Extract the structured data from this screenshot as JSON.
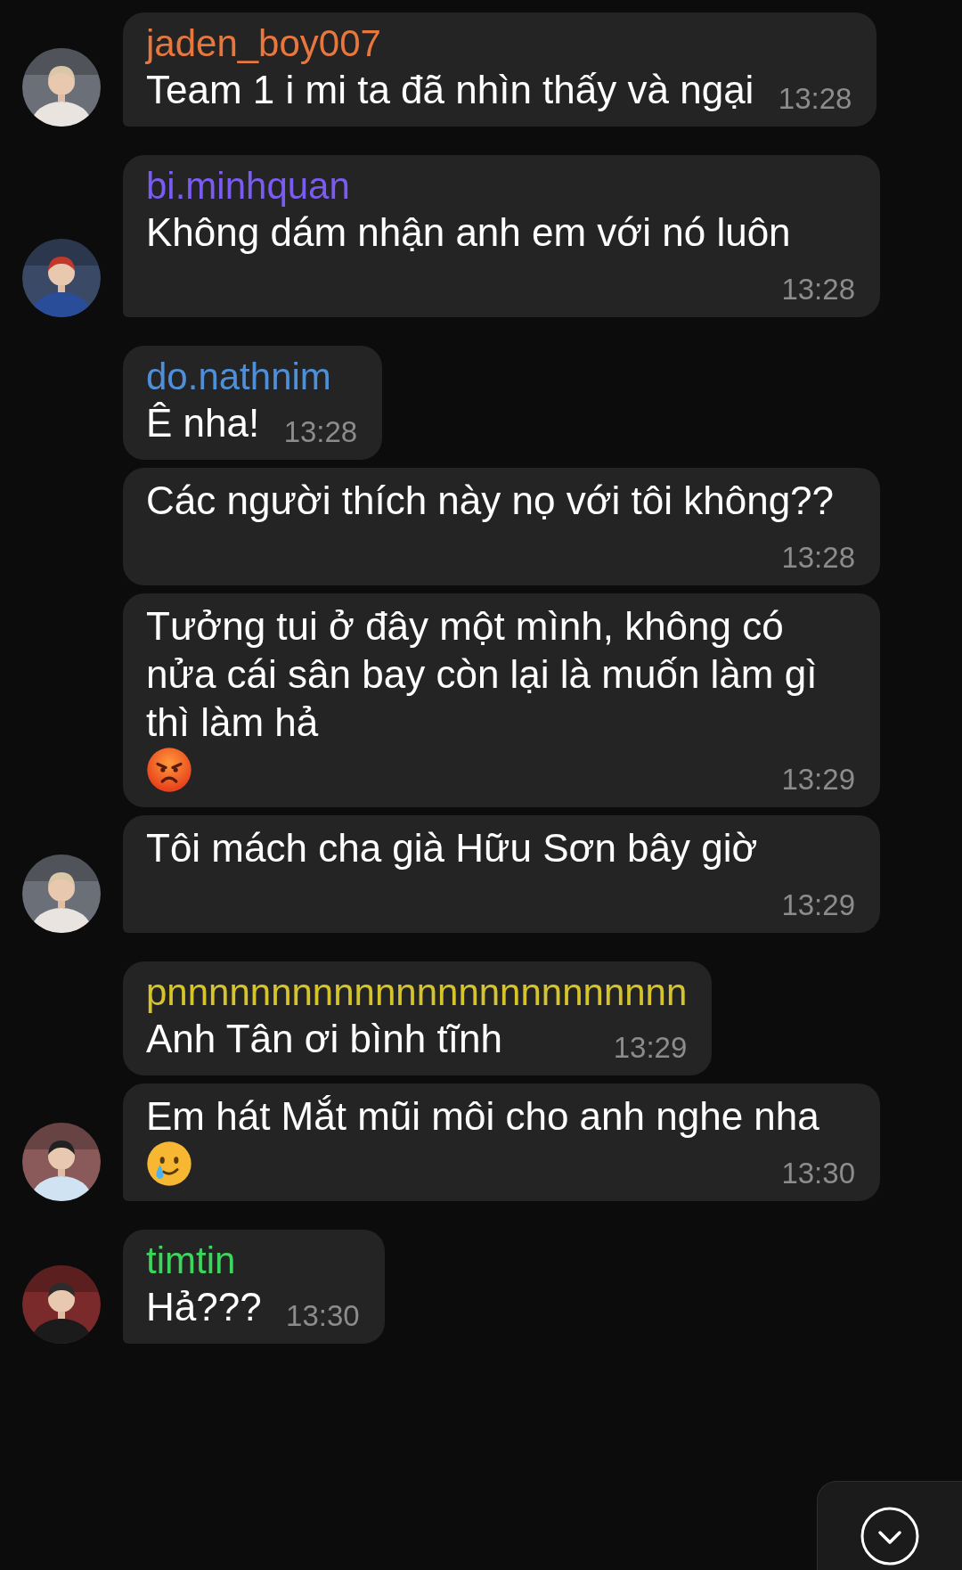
{
  "messages": [
    {
      "sender": {
        "name": "jaden_boy007",
        "color": "#e8773d"
      },
      "parts": [
        {
          "kind": "text",
          "text": "Team 1 i mi ta đã nhìn thấy và ngại"
        }
      ],
      "time": "13:28",
      "avatar": {
        "kind": "picture"
      },
      "group_end": true
    },
    {
      "sender": {
        "name": "bi.minhquan",
        "color": "#7b5cf2"
      },
      "parts": [
        {
          "kind": "text",
          "text": "Không dám nhận anh em với nó luôn"
        }
      ],
      "time": "13:28",
      "avatar": {
        "kind": "picture"
      },
      "group_end": true
    },
    {
      "sender": {
        "name": "do.nathnim",
        "color": "#4f8fd8"
      },
      "parts": [
        {
          "kind": "text",
          "text": "Ê nha!"
        }
      ],
      "time": "13:28",
      "group_end": false
    },
    {
      "parts": [
        {
          "kind": "text",
          "text": "Các người thích này nọ với tôi không??"
        }
      ],
      "time": "13:28",
      "group_end": false
    },
    {
      "parts": [
        {
          "kind": "text",
          "text": "Tưởng tui ở đây một mình, không có nửa cái sân bay còn lại là muốn làm gì thì làm hả"
        },
        {
          "kind": "angry_emoji"
        }
      ],
      "time": "13:29",
      "group_end": false
    },
    {
      "parts": [
        {
          "kind": "text",
          "text": "Tôi mách cha già Hữu Sơn bây giờ"
        }
      ],
      "time": "13:29",
      "avatar": {
        "kind": "picture"
      },
      "group_end": true
    },
    {
      "sender": {
        "name": "pnnnnnnnnnnnnnnnnnnnnnnnnn",
        "color": "#d6c42c"
      },
      "parts": [
        {
          "kind": "text",
          "text": "Anh Tân ơi bình tĩnh"
        }
      ],
      "time": "13:29",
      "group_end": false
    },
    {
      "parts": [
        {
          "kind": "text",
          "text": "Em hát Mắt mũi môi cho anh nghe nha"
        },
        {
          "kind": "tear_smile_emoji"
        }
      ],
      "time": "13:30",
      "avatar": {
        "kind": "picture"
      },
      "group_end": true
    },
    {
      "sender": {
        "name": "timtin",
        "color": "#3dd65c"
      },
      "parts": [
        {
          "kind": "text",
          "text": "Hả???"
        }
      ],
      "time": "13:30",
      "avatar": {
        "kind": "picture"
      },
      "group_end": true
    }
  ]
}
